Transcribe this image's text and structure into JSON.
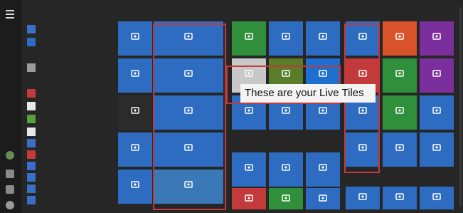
{
  "colors": {
    "tile_blue": "#2d6cc0",
    "tile_green": "#2f8f3a",
    "tile_orange": "#d8522a",
    "tile_purple": "#7b2f9c",
    "highlight_red": "#c23a3a",
    "menu_background": "#262626"
  },
  "rail": {
    "icons": [
      "hamburger-icon",
      "user-icon",
      "documents-icon",
      "settings-icon",
      "power-icon"
    ]
  },
  "app_list": {
    "items": [
      {
        "kind": "header",
        "icon": "hamburger-icon",
        "text": ""
      },
      {
        "kind": "app",
        "icon": "folder-icon",
        "text": "",
        "color": "#3a6fc8"
      },
      {
        "kind": "app",
        "icon": "app-icon",
        "text": "",
        "color": "#2d6cc0"
      },
      {
        "kind": "header",
        "icon": "letter-icon",
        "text": ""
      },
      {
        "kind": "app",
        "icon": "app-icon",
        "text": "",
        "color": "#9a9a9a"
      },
      {
        "kind": "header",
        "icon": "letter-icon",
        "text": ""
      },
      {
        "kind": "app",
        "icon": "app-icon",
        "text": "",
        "color": "#c23a3a"
      },
      {
        "kind": "app",
        "icon": "app-icon",
        "text": "",
        "color": "#e8e8e8"
      },
      {
        "kind": "app",
        "icon": "app-icon",
        "text": "",
        "color": "#55a13a"
      },
      {
        "kind": "app",
        "icon": "app-icon",
        "text": "",
        "color": "#e8e8e8"
      },
      {
        "kind": "app",
        "icon": "app-icon",
        "text": "",
        "color": "#3a6fc8"
      },
      {
        "kind": "app",
        "icon": "app-icon",
        "text": "",
        "color": "#c23a3a"
      },
      {
        "kind": "app",
        "icon": "app-icon",
        "text": "",
        "color": "#3a6fc8"
      },
      {
        "kind": "app",
        "icon": "app-icon",
        "text": "",
        "color": "#3a6fc8"
      },
      {
        "kind": "app",
        "icon": "app-icon",
        "text": "",
        "color": "#3a6fc8"
      },
      {
        "kind": "app",
        "icon": "app-icon",
        "text": "",
        "color": "#3a6fc8"
      }
    ]
  },
  "groups": [
    {
      "header": ""
    },
    {
      "header": ""
    },
    {
      "header": ""
    },
    {
      "header": ""
    },
    {
      "header": ""
    }
  ],
  "tiles": [
    {
      "name": "mail-tile",
      "icon": "mail-icon",
      "color": "#2d6cc0",
      "label": ""
    },
    {
      "name": "calendar-tile",
      "icon": "calendar-icon",
      "color": "#2d6cc0",
      "label": ""
    },
    {
      "name": "edge-tile",
      "icon": "edge-icon",
      "color": "#2d6cc0",
      "label": ""
    },
    {
      "name": "weather-tile",
      "icon": "cloud-icon",
      "color": "#2d6cc0",
      "label": ""
    },
    {
      "name": "chrome-tile",
      "icon": "chrome-icon",
      "color": "#2b2b2b",
      "label": ""
    },
    {
      "name": "cortana-tile",
      "icon": "cortana-icon",
      "color": "#2d6cc0",
      "label": ""
    },
    {
      "name": "groove-tile",
      "icon": "play-icon",
      "color": "#2d6cc0",
      "label": ""
    },
    {
      "name": "photos-tile",
      "icon": "photo-icon",
      "color": "#2d6cc0",
      "label": ""
    },
    {
      "name": "app-tile",
      "icon": "app-icon",
      "color": "#2d6cc0",
      "label": ""
    },
    {
      "name": "photo-preview-tile",
      "icon": "image-icon",
      "color": "#3b78b8",
      "label": ""
    },
    {
      "name": "store-app-tile",
      "icon": "app-icon",
      "color": "#2f8f3a",
      "label": ""
    },
    {
      "name": "browser-tile",
      "icon": "globe-icon",
      "color": "#2d6cc0",
      "label": ""
    },
    {
      "name": "store-tile",
      "icon": "store-icon",
      "color": "#2d6cc0",
      "label": ""
    },
    {
      "name": "solitaire-tile",
      "icon": "cards-icon",
      "color": "#c8c8c8",
      "label": ""
    },
    {
      "name": "minecraft-tile",
      "icon": "minecraft-icon",
      "color": "#5a7d2a",
      "label": ""
    },
    {
      "name": "shazam-tile",
      "icon": "shazam-icon",
      "color": "#1e6fd0",
      "label": ""
    },
    {
      "name": "word-tile",
      "icon": "doc-icon",
      "color": "#2d6cc0",
      "label": ""
    },
    {
      "name": "calculator-tile",
      "icon": "calculator-icon",
      "color": "#2d6cc0",
      "label": ""
    },
    {
      "name": "skype-tile",
      "icon": "chat-icon",
      "color": "#2d6cc0",
      "label": ""
    },
    {
      "name": "news-tile",
      "icon": "news-icon",
      "color": "#2d6cc0",
      "label": ""
    },
    {
      "name": "maps-tile",
      "icon": "map-icon",
      "color": "#2d6cc0",
      "label": ""
    },
    {
      "name": "photos-2-tile",
      "icon": "photo-icon",
      "color": "#2d6cc0",
      "label": ""
    },
    {
      "name": "red-app-tile",
      "icon": "app-icon",
      "color": "#c23a3a",
      "label": ""
    },
    {
      "name": "green-app-tile",
      "icon": "app-icon",
      "color": "#2f8f3a",
      "label": ""
    },
    {
      "name": "globe-2-tile",
      "icon": "globe-icon",
      "color": "#2d6cc0",
      "label": ""
    },
    {
      "name": "excel-tile",
      "icon": "excel-icon",
      "color": "#2d6cc0",
      "label": ""
    },
    {
      "name": "powerpoint-tile",
      "icon": "powerpoint-icon",
      "color": "#d8522a",
      "label": ""
    },
    {
      "name": "teams-tile",
      "icon": "teams-icon",
      "color": "#7b2f9c",
      "label": ""
    },
    {
      "name": "office-red-tile",
      "icon": "office-icon",
      "color": "#c23a3a",
      "label": ""
    },
    {
      "name": "office-green-tile",
      "icon": "office-icon",
      "color": "#2f8f3a",
      "label": ""
    },
    {
      "name": "office-purple-tile",
      "icon": "office-icon",
      "color": "#7b2f9c",
      "label": ""
    },
    {
      "name": "office-blue-tile",
      "icon": "office-icon",
      "color": "#2d6cc0",
      "label": ""
    },
    {
      "name": "office-green-2-tile",
      "icon": "office-icon",
      "color": "#2f8f3a",
      "label": ""
    },
    {
      "name": "outlook-tile",
      "icon": "outlook-icon",
      "color": "#2d6cc0",
      "label": ""
    },
    {
      "name": "onedrive-tile",
      "icon": "onedrive-icon",
      "color": "#2d6cc0",
      "label": ""
    },
    {
      "name": "onenote-tile",
      "icon": "onenote-icon",
      "color": "#2d6cc0",
      "label": ""
    },
    {
      "name": "project-tile",
      "icon": "project-icon",
      "color": "#2d6cc0",
      "label": ""
    },
    {
      "name": "bottom-app-1-tile",
      "icon": "app-icon",
      "color": "#2d6cc0",
      "label": ""
    },
    {
      "name": "bottom-app-2-tile",
      "icon": "app-icon",
      "color": "#2d6cc0",
      "label": ""
    },
    {
      "name": "bottom-app-3-tile",
      "icon": "app-icon",
      "color": "#2d6cc0",
      "label": ""
    }
  ],
  "callout": {
    "text": "These are your Live Tiles"
  }
}
